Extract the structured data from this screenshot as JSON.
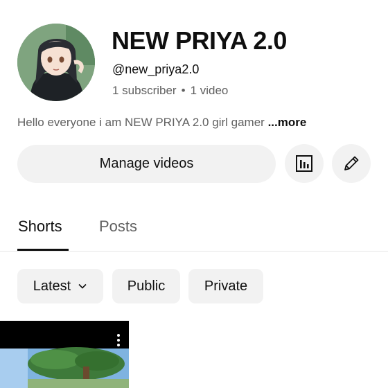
{
  "channel": {
    "name": "NEW PRIYA 2.0",
    "handle": "@new_priya2.0",
    "subscribers": "1 subscriber",
    "separator": "•",
    "videos": "1 video",
    "bio": "Hello everyone i am NEW PRIYA 2.0 girl gamer",
    "more_label": "...more"
  },
  "actions": {
    "manage_label": "Manage videos",
    "analytics_icon": "bar-chart-icon",
    "edit_icon": "pencil-icon"
  },
  "tabs": [
    {
      "label": "Shorts",
      "selected": true
    },
    {
      "label": "Posts",
      "selected": false
    }
  ],
  "filters": [
    {
      "label": "Latest",
      "has_dropdown": true
    },
    {
      "label": "Public",
      "has_dropdown": false
    },
    {
      "label": "Private",
      "has_dropdown": false
    }
  ],
  "colors": {
    "text_primary": "#0f0f0f",
    "text_secondary": "#606060",
    "chip_background": "#f2f2f2"
  }
}
